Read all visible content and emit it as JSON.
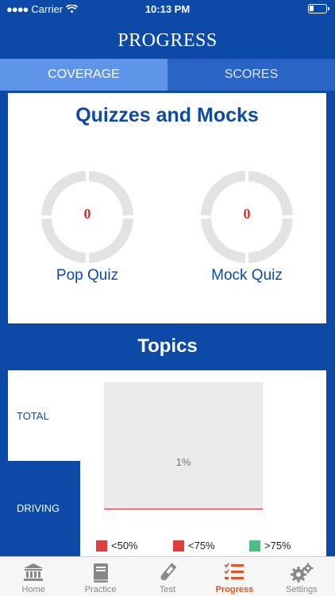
{
  "status_bar": {
    "carrier": "Carrier",
    "time": "10:13 PM"
  },
  "header": {
    "title": "PROGRESS"
  },
  "tabs": [
    {
      "label": "COVERAGE",
      "active": true
    },
    {
      "label": "SCORES",
      "active": false
    }
  ],
  "quizzes_card": {
    "title": "Quizzes and Mocks",
    "items": [
      {
        "label": "Pop Quiz",
        "value": "0"
      },
      {
        "label": "Mock Quiz",
        "value": "0"
      }
    ]
  },
  "topics": {
    "title": "Topics",
    "rows": [
      {
        "label": "TOTAL"
      },
      {
        "label": "DRIVING"
      }
    ],
    "chart": {
      "percent_label": "1%",
      "fill_fraction": 0.01
    },
    "legend": [
      {
        "label": "<50%",
        "color": "#e03d3d"
      },
      {
        "label": "<75%",
        "color": "#e03d3d"
      },
      {
        "label": ">75%",
        "color": "#4cbf86"
      }
    ]
  },
  "bottom_nav": [
    {
      "label": "Home",
      "icon": "bank-icon",
      "active": false
    },
    {
      "label": "Practice",
      "icon": "book-icon",
      "active": false
    },
    {
      "label": "Test",
      "icon": "test-tube-icon",
      "active": false
    },
    {
      "label": "Progress",
      "icon": "checklist-icon",
      "active": true
    },
    {
      "label": "Settings",
      "icon": "gears-icon",
      "active": false
    }
  ]
}
